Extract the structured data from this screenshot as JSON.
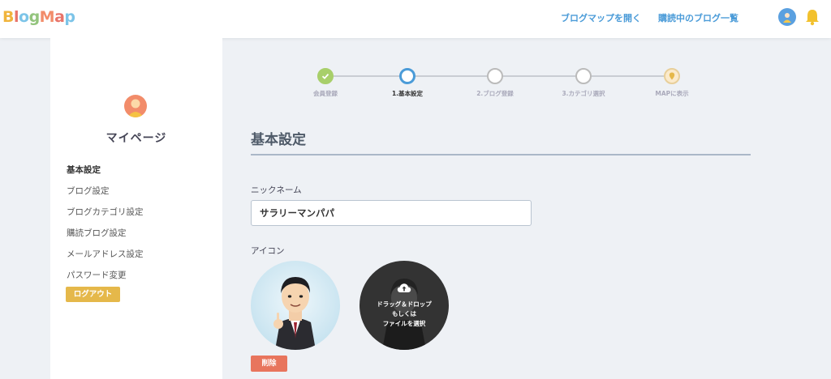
{
  "header": {
    "logo": [
      "B",
      "l",
      "o",
      "g",
      "M",
      "a",
      "p"
    ],
    "logo_colors": [
      "#f0b43c",
      "#e8746a",
      "#7cc4e8",
      "#93c47d",
      "#f28c6a",
      "#e8746a",
      "#7cc4e8"
    ],
    "open_map_label": "ブログマップを開く",
    "subscribed_label": "購読中のブログ一覧"
  },
  "sidebar": {
    "title": "マイページ",
    "items": [
      {
        "label": "基本設定"
      },
      {
        "label": "ブログ設定"
      },
      {
        "label": "ブログカテゴリ設定"
      },
      {
        "label": "購読ブログ設定"
      },
      {
        "label": "メールアドレス設定"
      },
      {
        "label": "パスワード変更"
      }
    ],
    "logout_label": "ログアウト"
  },
  "steps": [
    {
      "label": "会員登録",
      "state": "done"
    },
    {
      "label": "1.基本設定",
      "state": "current"
    },
    {
      "label": "2.ブログ登録",
      "state": "todo"
    },
    {
      "label": "3.カテゴリ選択",
      "state": "todo"
    },
    {
      "label": "MAPに表示",
      "state": "final"
    }
  ],
  "form": {
    "section_title": "基本設定",
    "nickname_label": "ニックネーム",
    "nickname_value": "サラリーマンパパ",
    "icon_label": "アイコン",
    "drop_line1": "ドラッグ＆ドロップ",
    "drop_line2": "もしくは",
    "drop_line3": "ファイルを選択",
    "delete_label": "削除"
  },
  "colors": {
    "accent_blue": "#4a9bd8",
    "logout_yellow": "#e5b84a",
    "delete_red": "#e8755d",
    "step_done_green": "#a8cf6a"
  }
}
